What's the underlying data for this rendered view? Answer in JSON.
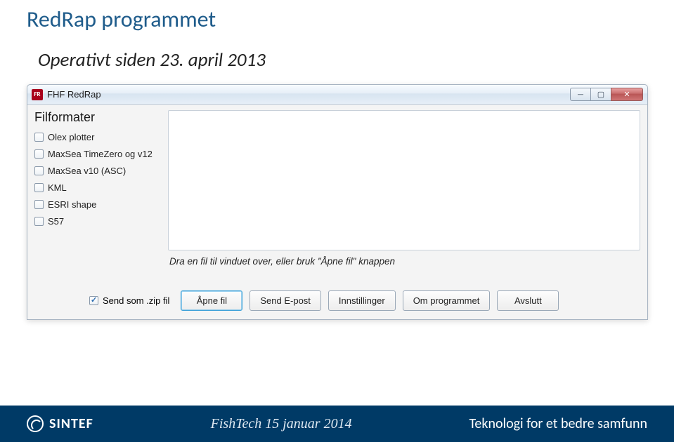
{
  "slide": {
    "title": "RedRap programmet",
    "subtitle": "Operativt siden 23. april 2013"
  },
  "window": {
    "app_icon_text": "FR",
    "title": "FHF RedRap",
    "controls": {
      "minimize": "—",
      "maximize": "▢",
      "close": "✕"
    }
  },
  "formats": {
    "header": "Filformater",
    "items": [
      {
        "label": "Olex plotter",
        "checked": false
      },
      {
        "label": "MaxSea TimeZero og v12",
        "checked": false
      },
      {
        "label": "MaxSea v10 (ASC)",
        "checked": false
      },
      {
        "label": "KML",
        "checked": false
      },
      {
        "label": "ESRI shape",
        "checked": false
      },
      {
        "label": "S57",
        "checked": false
      }
    ]
  },
  "hint": "Dra en fil til vinduet over, eller bruk \"Åpne fil\" knappen",
  "bottom": {
    "zip_label": "Send som .zip fil",
    "zip_checked": true,
    "buttons": {
      "open": "Åpne fil",
      "send": "Send E-post",
      "settings": "Innstillinger",
      "about": "Om programmet",
      "quit": "Avslutt"
    }
  },
  "footer": {
    "logo": "SINTEF",
    "center": "FishTech 15 januar 2014",
    "right": "Teknologi for et bedre samfunn"
  }
}
